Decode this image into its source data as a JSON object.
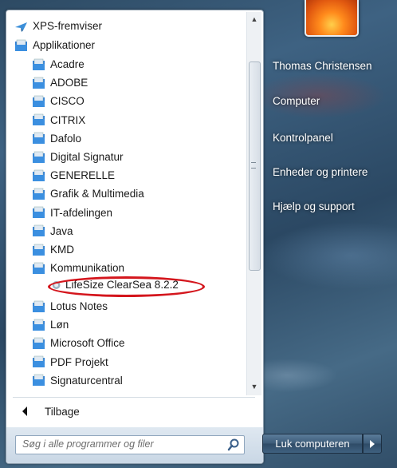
{
  "programs": {
    "top_items": [
      {
        "label": "XPS-fremviser",
        "icon": "xps-viewer-icon"
      },
      {
        "label": "Applikationer",
        "icon": "folder-icon"
      }
    ],
    "folders": [
      {
        "label": "Acadre"
      },
      {
        "label": "ADOBE"
      },
      {
        "label": "CISCO"
      },
      {
        "label": "CITRIX"
      },
      {
        "label": "Dafolo"
      },
      {
        "label": "Digital Signatur"
      },
      {
        "label": "GENERELLE"
      },
      {
        "label": "Grafik & Multimedia"
      },
      {
        "label": "IT-afdelingen"
      },
      {
        "label": "Java"
      },
      {
        "label": "KMD"
      },
      {
        "label": "Kommunikation"
      }
    ],
    "subitem": {
      "label": "LifeSize ClearSea 8.2.2",
      "icon": "lifesize-app-icon"
    },
    "folders_after": [
      {
        "label": "Lotus Notes"
      },
      {
        "label": "Løn"
      },
      {
        "label": "Microsoft Office"
      },
      {
        "label": "PDF Projekt"
      },
      {
        "label": "Signaturcentral"
      }
    ],
    "back_label": "Tilbage"
  },
  "search": {
    "placeholder": "Søg i alle programmer og filer"
  },
  "right_menu": {
    "user_name": "Thomas Christensen",
    "items": [
      "Computer",
      "Kontrolpanel",
      "Enheder og printere",
      "Hjælp og support"
    ]
  },
  "shutdown": {
    "label": "Luk computeren"
  },
  "colors": {
    "annotation_ellipse": "#d4161d",
    "folder_blue": "#2f7fd6"
  }
}
